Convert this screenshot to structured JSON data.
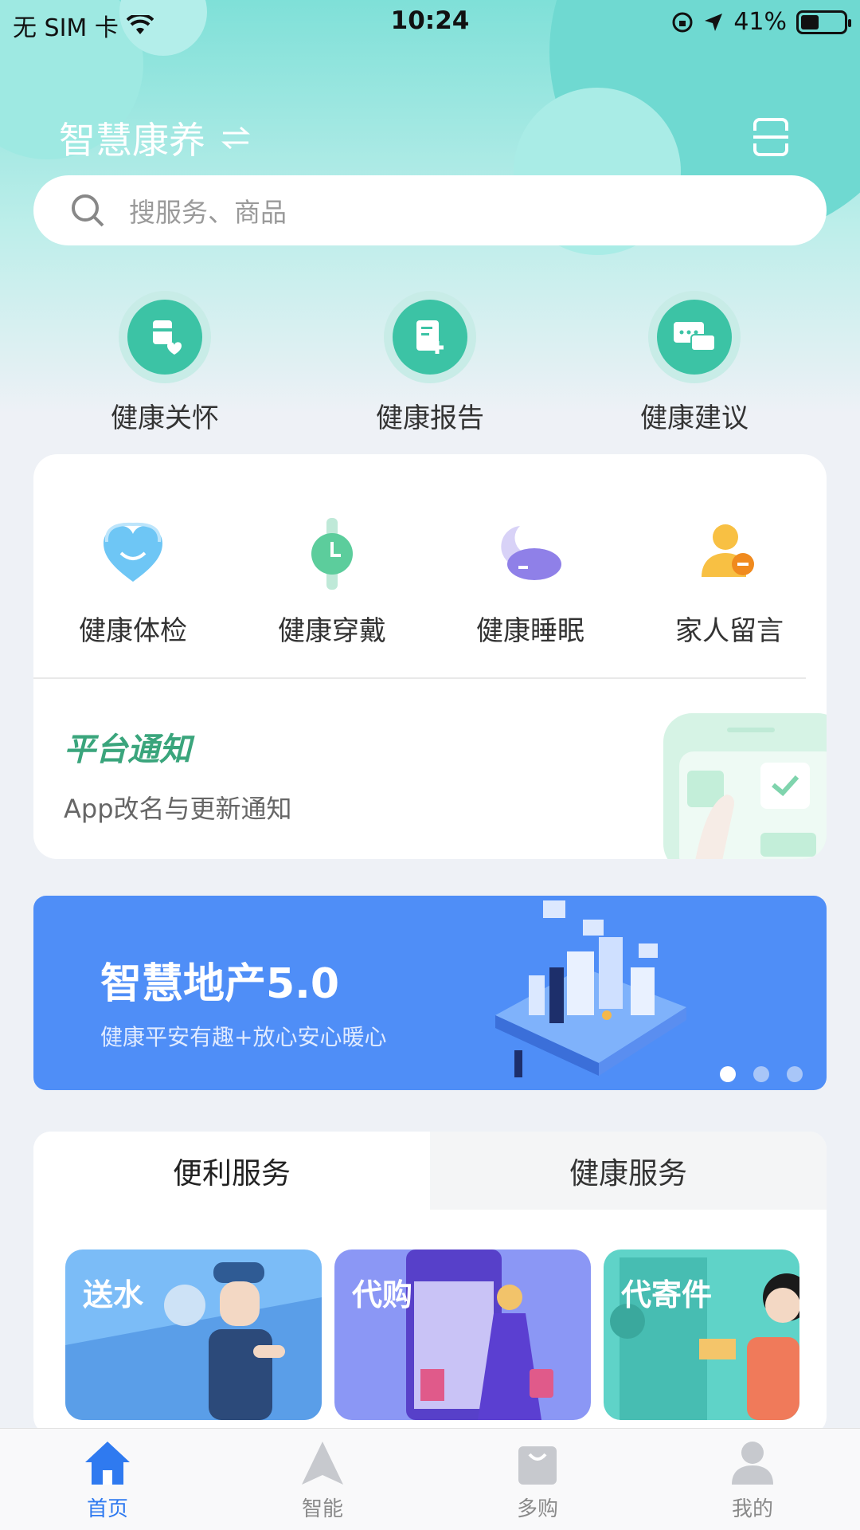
{
  "status_bar": {
    "carrier": "无 SIM 卡",
    "time": "10:24",
    "battery": "41%"
  },
  "header": {
    "title": "智慧康养",
    "switch_icon": "swap-icon",
    "scan_icon": "scan-icon"
  },
  "search": {
    "placeholder": "搜服务、商品"
  },
  "top_actions": [
    {
      "label": "健康关怀",
      "icon": "health-care-icon"
    },
    {
      "label": "健康报告",
      "icon": "health-report-icon"
    },
    {
      "label": "健康建议",
      "icon": "health-advice-icon"
    }
  ],
  "grid": [
    {
      "label": "健康体检",
      "icon": "heart-face-icon"
    },
    {
      "label": "健康穿戴",
      "icon": "watch-icon"
    },
    {
      "label": "健康睡眠",
      "icon": "sleep-moon-icon"
    },
    {
      "label": "家人留言",
      "icon": "family-message-icon"
    }
  ],
  "notice": {
    "title": "平台通知",
    "text": "App改名与更新通知"
  },
  "banner": {
    "title": "智慧地产5.0",
    "subtitle": "健康平安有趣+放心安心暖心",
    "active_dot": 0
  },
  "services": {
    "tabs": [
      "便利服务",
      "健康服务"
    ],
    "active_tab": 0,
    "items": [
      "送水",
      "代购",
      "代寄件"
    ]
  },
  "tabbar": [
    {
      "label": "首页",
      "icon": "home-icon",
      "active": true
    },
    {
      "label": "智能",
      "icon": "navigate-icon",
      "active": false
    },
    {
      "label": "多购",
      "icon": "shopping-bag-icon",
      "active": false
    },
    {
      "label": "我的",
      "icon": "user-icon",
      "active": false
    }
  ],
  "colors": {
    "accent": "#3cc3a5",
    "banner": "#4f8ef7",
    "tab_active": "#2f7af0"
  }
}
